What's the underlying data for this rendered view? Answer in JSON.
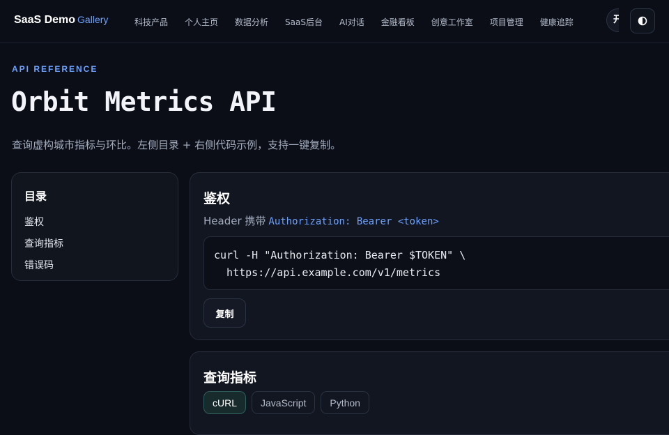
{
  "nav": {
    "brand": "SaaS Demo",
    "brand_sub": "Gallery",
    "links": [
      "科技产品",
      "个人主页",
      "数据分析",
      "SaaS后台",
      "AI对话",
      "金融看板",
      "创意工作室",
      "项目管理",
      "健康追踪"
    ],
    "overflow_label": "开",
    "theme_icon": "contrast-icon"
  },
  "hero": {
    "eyebrow": "API REFERENCE",
    "title": "Orbit Metrics API",
    "lede": "查询虚构城市指标与环比。左侧目录 + 右侧代码示例，支持一键复制。"
  },
  "toc": {
    "title": "目录",
    "items": [
      "鉴权",
      "查询指标",
      "错误码"
    ]
  },
  "auth": {
    "title": "鉴权",
    "desc_prefix": "Header 携带",
    "desc_code": "Authorization: Bearer <token>",
    "code": "curl -H \"Authorization: Bearer $TOKEN\" \\\n  https://api.example.com/v1/metrics",
    "copy_label": "复制"
  },
  "query": {
    "title": "查询指标",
    "tabs": [
      "cURL",
      "JavaScript",
      "Python"
    ],
    "active_tab": "cURL"
  },
  "colors": {
    "accent": "#6ea2ff",
    "background": "#0b0e16",
    "card": "#121620",
    "active_tab": "#172a2c"
  }
}
